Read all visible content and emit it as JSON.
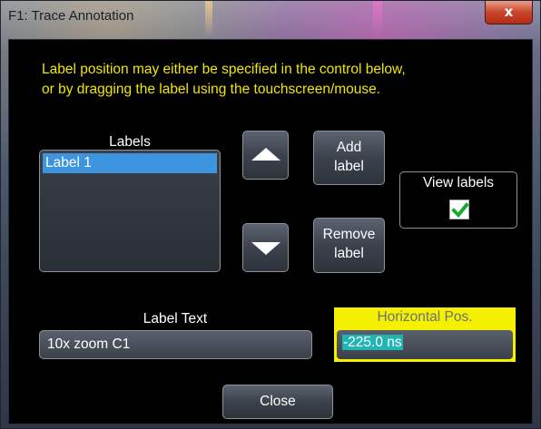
{
  "window": {
    "title": "F1: Trace Annotation",
    "close_glyph": "x"
  },
  "info": {
    "line1": "Label position may either be specified in the control below,",
    "line2": "or by dragging the label using the touchscreen/mouse."
  },
  "labels": {
    "heading": "Labels",
    "items": [
      "Label 1"
    ],
    "selected_index": 0
  },
  "buttons": {
    "move_up_icon": "arrow-up-icon",
    "move_down_icon": "arrow-down-icon",
    "add_line1": "Add",
    "add_line2": "label",
    "remove_line1": "Remove",
    "remove_line2": "label",
    "close": "Close"
  },
  "view_labels": {
    "label": "View labels",
    "checked": true
  },
  "label_text": {
    "heading": "Label Text",
    "value": "10x zoom C1"
  },
  "horizontal_pos": {
    "heading": "Horizontal Pos.",
    "value": "-225.0 ns"
  },
  "colors": {
    "info_text": "#f2e600",
    "selection": "#3d95df",
    "highlight_bg": "#f5f000",
    "value_highlight": "#20b4b4",
    "checkmark": "#1aa830"
  }
}
